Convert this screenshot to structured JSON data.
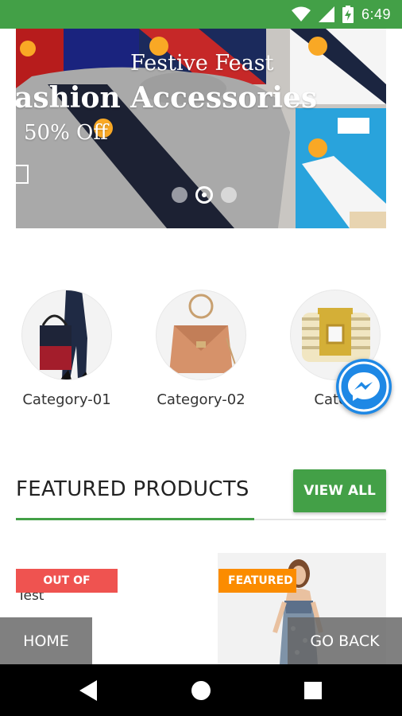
{
  "status_bar": {
    "time": "6:49",
    "icons": [
      "wifi-icon",
      "signal-icon",
      "battery-charging-icon"
    ],
    "color": "#43a047"
  },
  "banner": {
    "subtitle": "Festive Feast",
    "title": "ashion Accessories",
    "offer": "50% Off",
    "slides": 3,
    "active_slide": 2
  },
  "categories": [
    {
      "label": "Category-01",
      "image": "handbag-photo"
    },
    {
      "label": "Category-02",
      "image": "tan-handbag-photo"
    },
    {
      "label": "Categ",
      "image": "jeweled-cuff-photo"
    }
  ],
  "featured": {
    "title": "FEATURED PRODUCTS",
    "view_all_label": "VIEW ALL",
    "accent_color": "#43a047"
  },
  "products": [
    {
      "name": "Test",
      "badge": "OUT OF STOCK",
      "badge_color": "#ef5350"
    },
    {
      "name": "",
      "badge": "FEATURED",
      "badge_color": "#fb8c00"
    }
  ],
  "bottom_buttons": {
    "home_label": "HOME",
    "back_label": "GO BACK"
  },
  "messenger": {
    "icon": "messenger-icon",
    "color": "#1e88e5"
  },
  "nav_bar": {
    "icons": [
      "back-icon",
      "home-icon",
      "recents-icon"
    ]
  }
}
